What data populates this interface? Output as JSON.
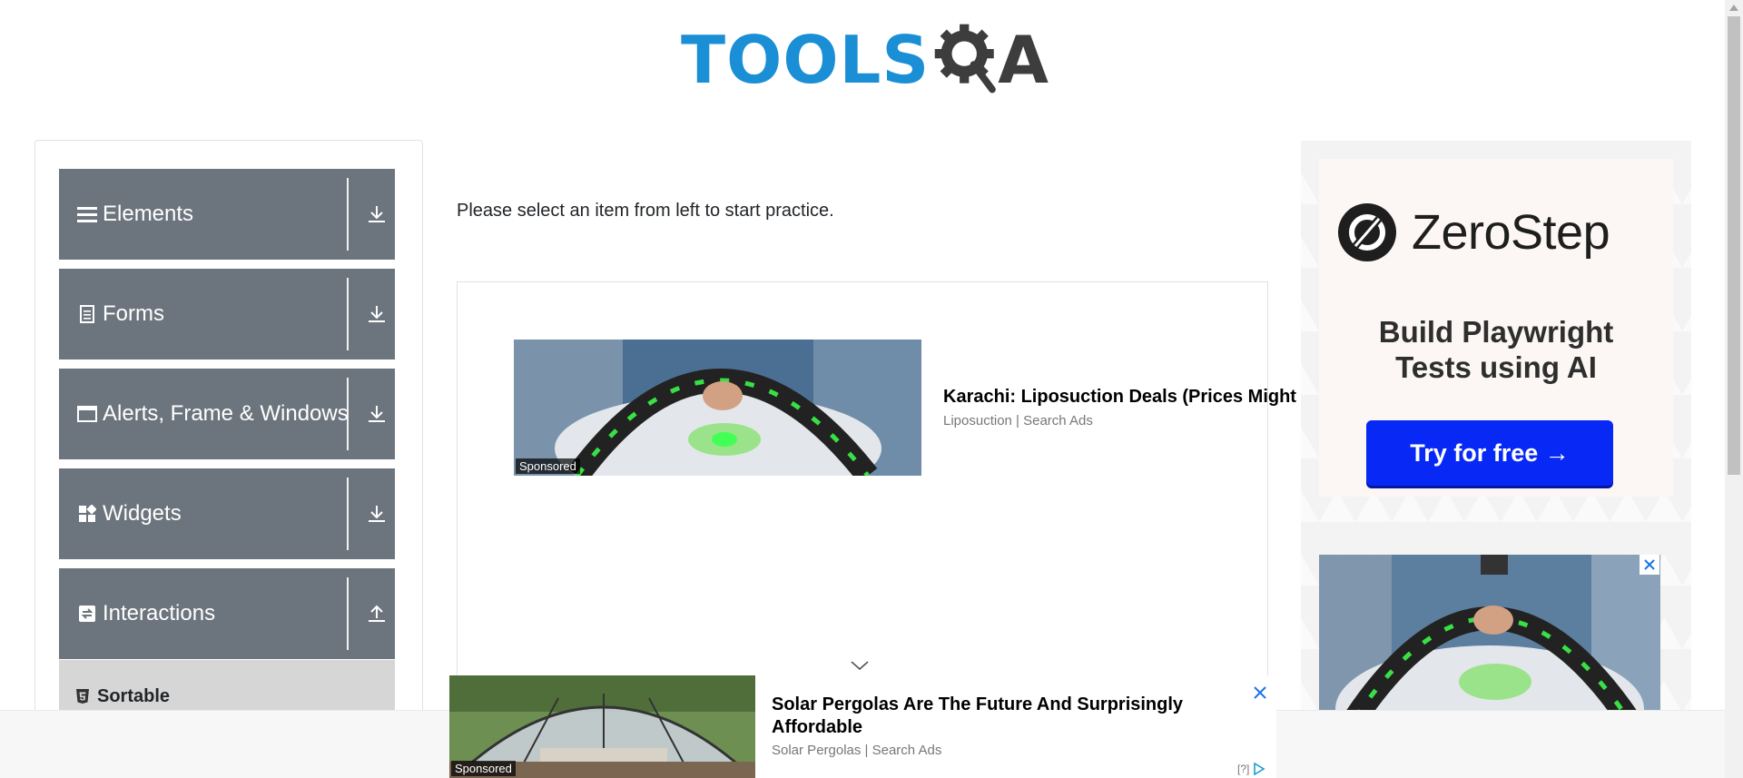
{
  "header": {
    "logo_text": "TOOLS",
    "logo_suffix": "A"
  },
  "sidebar": {
    "groups": [
      {
        "label": "Elements",
        "icon": "hamburger-icon",
        "arrow": "download-arrow-icon"
      },
      {
        "label": "Forms",
        "icon": "document-icon",
        "arrow": "download-arrow-icon"
      },
      {
        "label": "Alerts, Frame & Windows",
        "icon": "window-icon",
        "arrow": "download-arrow-icon"
      },
      {
        "label": "Widgets",
        "icon": "widgets-icon",
        "arrow": "download-arrow-icon"
      },
      {
        "label": "Interactions",
        "icon": "interactions-icon",
        "arrow": "upload-arrow-icon"
      }
    ],
    "sub_items": [
      {
        "label": "Sortable",
        "icon": "html5-icon"
      }
    ]
  },
  "main": {
    "instruction": "Please select an item from left to start practice.",
    "ad": {
      "sponsored": "Sponsored",
      "title": "Karachi: Liposuction Deals (Prices Might",
      "source": "Liposuction | Search Ads"
    }
  },
  "right_ad": {
    "brand": "ZeroStep",
    "headline_line1": "Build Playwright",
    "headline_line2": "Tests using AI",
    "cta": "Try for free →"
  },
  "bottom_ad": {
    "sponsored": "Sponsored",
    "title": "Solar Pergolas Are The Future And Surprisingly Affordable",
    "source": "Solar Pergolas | Search Ads",
    "adchoice": "[?]"
  },
  "colors": {
    "sidebar_group_bg": "#6c757d",
    "sub_item_bg": "#d6d6d6",
    "logo_blue": "#1a8fd5",
    "logo_dark": "#3d3d3d",
    "cta_blue": "#0829f5"
  }
}
